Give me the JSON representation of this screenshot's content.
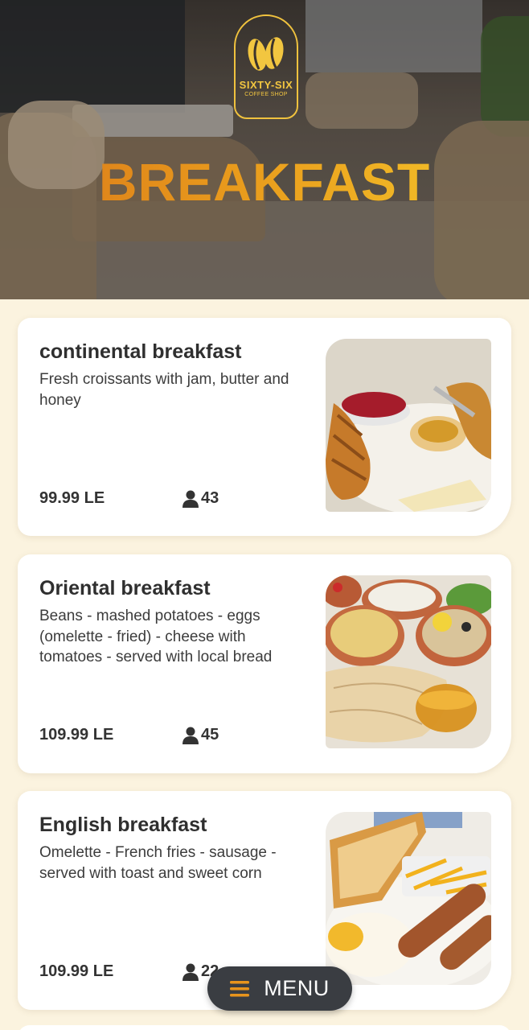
{
  "brand": {
    "name": "SIXTY-SIX",
    "tagline": "COFFEE SHOP",
    "accent": "#f2c640"
  },
  "hero": {
    "title": "BREAKFAST"
  },
  "items": [
    {
      "title": "continental breakfast",
      "description": "Fresh croissants with jam, butter and honey",
      "price": "99.99 LE",
      "likes": "43"
    },
    {
      "title": "Oriental breakfast",
      "description": "Beans - mashed potatoes - eggs (omelette - fried) - cheese with tomatoes - served with local bread",
      "price": "109.99 LE",
      "likes": "45"
    },
    {
      "title": "English breakfast",
      "description": "Omelette - French fries - sausage -\nserved with toast and sweet corn",
      "price": "109.99 LE",
      "likes": "22"
    }
  ],
  "menu_button": {
    "label": "MENU"
  },
  "colors": {
    "background": "#fbf3df",
    "card": "#ffffff",
    "text": "#2f2f2f",
    "button": "#3a3d42",
    "title_gradient_start": "#d9781a",
    "title_gradient_end": "#f5c82b"
  }
}
